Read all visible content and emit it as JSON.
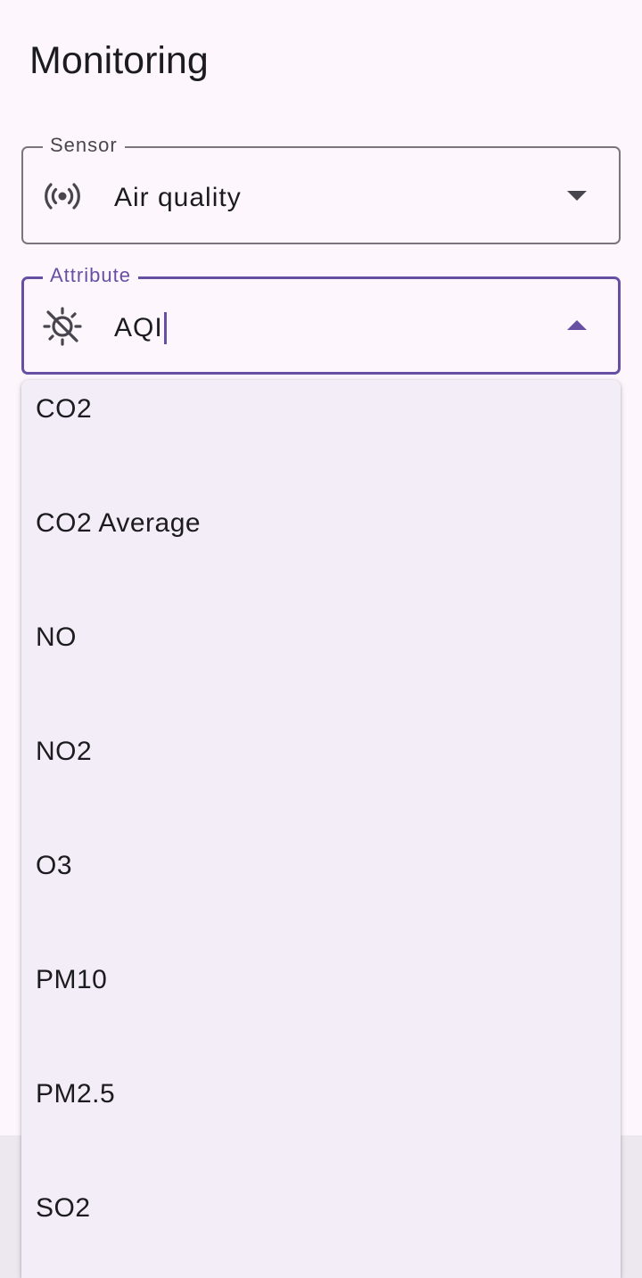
{
  "header": {
    "title": "Monitoring"
  },
  "sensor_field": {
    "label": "Sensor",
    "value": "Air quality",
    "icon": "sensors-icon"
  },
  "attribute_field": {
    "label": "Attribute",
    "value": "AQI",
    "icon": "air-quality-off-icon",
    "state": "focused, menu open"
  },
  "attribute_menu": {
    "options": [
      "CO2",
      "CO2 Average",
      "NO",
      "NO2",
      "O3",
      "PM10",
      "PM2.5",
      "SO2"
    ]
  },
  "colors": {
    "background": "#fdf7fd",
    "accent": "#6750a4",
    "outline": "#7a757f",
    "menu_surface": "#f2edf6",
    "text": "#1c1b1f"
  }
}
